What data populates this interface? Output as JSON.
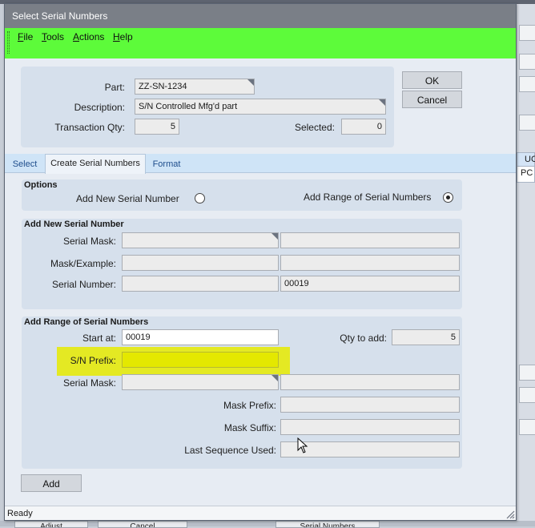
{
  "window": {
    "title": "Select Serial Numbers"
  },
  "menu": {
    "file": {
      "first": "F",
      "rest": "ile"
    },
    "tools": {
      "first": "T",
      "rest": "ools"
    },
    "actions": {
      "first": "A",
      "rest": "ctions"
    },
    "help": {
      "first": "H",
      "rest": "elp"
    }
  },
  "header": {
    "part_label": "Part:",
    "part_value": "ZZ-SN-1234",
    "description_label": "Description:",
    "description_value": "S/N Controlled Mfg'd part",
    "transaction_qty_label": "Transaction Qty:",
    "transaction_qty_value": "5",
    "selected_label": "Selected:",
    "selected_value": "0"
  },
  "buttons": {
    "ok": "OK",
    "cancel": "Cancel",
    "add": "Add"
  },
  "tabs": [
    {
      "label": "Select"
    },
    {
      "label": "Create Serial Numbers"
    },
    {
      "label": "Format"
    }
  ],
  "options": {
    "title": "Options",
    "add_new_label": "Add New Serial Number",
    "add_range_label": "Add Range of Serial Numbers",
    "selected": "range"
  },
  "add_new": {
    "title": "Add New Serial Number",
    "serial_mask_label": "Serial Mask:",
    "mask_example_label": "Mask/Example:",
    "serial_number_label": "Serial Number:",
    "serial_number_value": "00019"
  },
  "add_range": {
    "title": "Add Range of Serial Numbers",
    "start_at_label": "Start at:",
    "start_at_value": "00019",
    "qty_to_add_label": "Qty to add:",
    "qty_to_add_value": "5",
    "sn_prefix_label": "S/N Prefix:",
    "serial_mask_label": "Serial Mask:",
    "mask_prefix_label": "Mask Prefix:",
    "mask_suffix_label": "Mask Suffix:",
    "last_sequence_label": "Last Sequence Used:"
  },
  "status": {
    "text": "Ready"
  },
  "background": {
    "uc": "UC",
    "pc": "PC",
    "tabs": [
      "Adjust",
      "Cancel",
      "Serial Numbers"
    ]
  },
  "colors": {
    "menubar": "#5dfb3a",
    "highlight": "#e6ea00",
    "tab_strip": "#cfe4f7"
  }
}
